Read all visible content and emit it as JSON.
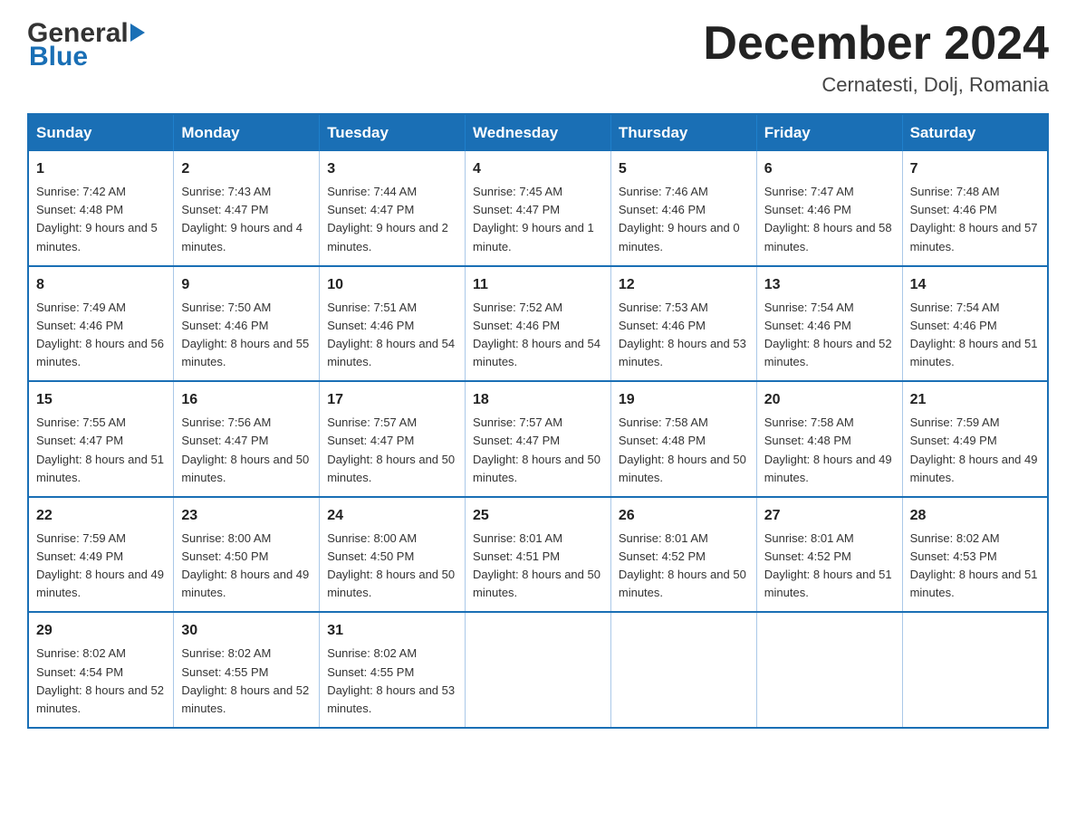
{
  "header": {
    "logo_general": "General",
    "logo_blue": "Blue",
    "month_title": "December 2024",
    "location": "Cernatesti, Dolj, Romania"
  },
  "days_of_week": [
    "Sunday",
    "Monday",
    "Tuesday",
    "Wednesday",
    "Thursday",
    "Friday",
    "Saturday"
  ],
  "weeks": [
    [
      {
        "day": "1",
        "sunrise": "7:42 AM",
        "sunset": "4:48 PM",
        "daylight": "9 hours and 5 minutes."
      },
      {
        "day": "2",
        "sunrise": "7:43 AM",
        "sunset": "4:47 PM",
        "daylight": "9 hours and 4 minutes."
      },
      {
        "day": "3",
        "sunrise": "7:44 AM",
        "sunset": "4:47 PM",
        "daylight": "9 hours and 2 minutes."
      },
      {
        "day": "4",
        "sunrise": "7:45 AM",
        "sunset": "4:47 PM",
        "daylight": "9 hours and 1 minute."
      },
      {
        "day": "5",
        "sunrise": "7:46 AM",
        "sunset": "4:46 PM",
        "daylight": "9 hours and 0 minutes."
      },
      {
        "day": "6",
        "sunrise": "7:47 AM",
        "sunset": "4:46 PM",
        "daylight": "8 hours and 58 minutes."
      },
      {
        "day": "7",
        "sunrise": "7:48 AM",
        "sunset": "4:46 PM",
        "daylight": "8 hours and 57 minutes."
      }
    ],
    [
      {
        "day": "8",
        "sunrise": "7:49 AM",
        "sunset": "4:46 PM",
        "daylight": "8 hours and 56 minutes."
      },
      {
        "day": "9",
        "sunrise": "7:50 AM",
        "sunset": "4:46 PM",
        "daylight": "8 hours and 55 minutes."
      },
      {
        "day": "10",
        "sunrise": "7:51 AM",
        "sunset": "4:46 PM",
        "daylight": "8 hours and 54 minutes."
      },
      {
        "day": "11",
        "sunrise": "7:52 AM",
        "sunset": "4:46 PM",
        "daylight": "8 hours and 54 minutes."
      },
      {
        "day": "12",
        "sunrise": "7:53 AM",
        "sunset": "4:46 PM",
        "daylight": "8 hours and 53 minutes."
      },
      {
        "day": "13",
        "sunrise": "7:54 AM",
        "sunset": "4:46 PM",
        "daylight": "8 hours and 52 minutes."
      },
      {
        "day": "14",
        "sunrise": "7:54 AM",
        "sunset": "4:46 PM",
        "daylight": "8 hours and 51 minutes."
      }
    ],
    [
      {
        "day": "15",
        "sunrise": "7:55 AM",
        "sunset": "4:47 PM",
        "daylight": "8 hours and 51 minutes."
      },
      {
        "day": "16",
        "sunrise": "7:56 AM",
        "sunset": "4:47 PM",
        "daylight": "8 hours and 50 minutes."
      },
      {
        "day": "17",
        "sunrise": "7:57 AM",
        "sunset": "4:47 PM",
        "daylight": "8 hours and 50 minutes."
      },
      {
        "day": "18",
        "sunrise": "7:57 AM",
        "sunset": "4:47 PM",
        "daylight": "8 hours and 50 minutes."
      },
      {
        "day": "19",
        "sunrise": "7:58 AM",
        "sunset": "4:48 PM",
        "daylight": "8 hours and 50 minutes."
      },
      {
        "day": "20",
        "sunrise": "7:58 AM",
        "sunset": "4:48 PM",
        "daylight": "8 hours and 49 minutes."
      },
      {
        "day": "21",
        "sunrise": "7:59 AM",
        "sunset": "4:49 PM",
        "daylight": "8 hours and 49 minutes."
      }
    ],
    [
      {
        "day": "22",
        "sunrise": "7:59 AM",
        "sunset": "4:49 PM",
        "daylight": "8 hours and 49 minutes."
      },
      {
        "day": "23",
        "sunrise": "8:00 AM",
        "sunset": "4:50 PM",
        "daylight": "8 hours and 49 minutes."
      },
      {
        "day": "24",
        "sunrise": "8:00 AM",
        "sunset": "4:50 PM",
        "daylight": "8 hours and 50 minutes."
      },
      {
        "day": "25",
        "sunrise": "8:01 AM",
        "sunset": "4:51 PM",
        "daylight": "8 hours and 50 minutes."
      },
      {
        "day": "26",
        "sunrise": "8:01 AM",
        "sunset": "4:52 PM",
        "daylight": "8 hours and 50 minutes."
      },
      {
        "day": "27",
        "sunrise": "8:01 AM",
        "sunset": "4:52 PM",
        "daylight": "8 hours and 51 minutes."
      },
      {
        "day": "28",
        "sunrise": "8:02 AM",
        "sunset": "4:53 PM",
        "daylight": "8 hours and 51 minutes."
      }
    ],
    [
      {
        "day": "29",
        "sunrise": "8:02 AM",
        "sunset": "4:54 PM",
        "daylight": "8 hours and 52 minutes."
      },
      {
        "day": "30",
        "sunrise": "8:02 AM",
        "sunset": "4:55 PM",
        "daylight": "8 hours and 52 minutes."
      },
      {
        "day": "31",
        "sunrise": "8:02 AM",
        "sunset": "4:55 PM",
        "daylight": "8 hours and 53 minutes."
      },
      null,
      null,
      null,
      null
    ]
  ]
}
